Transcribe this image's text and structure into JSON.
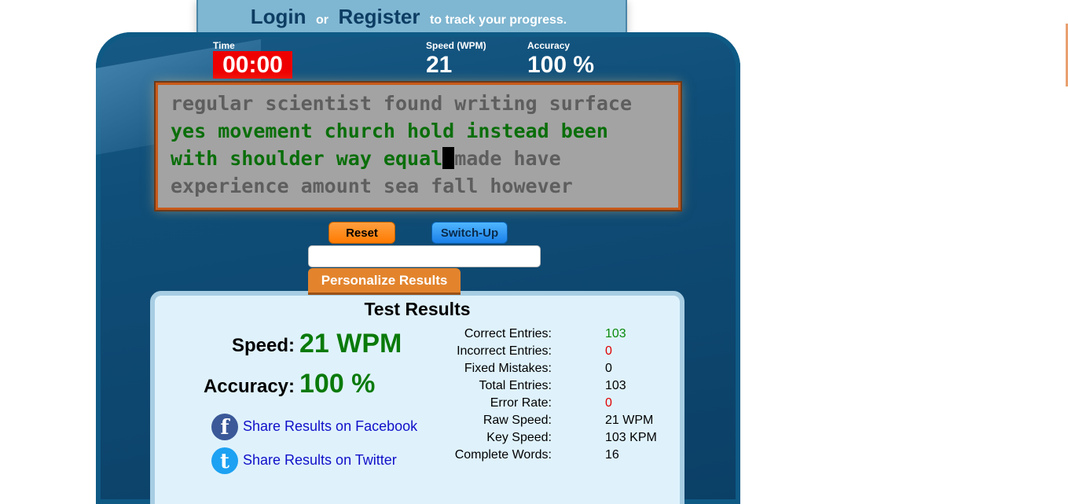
{
  "banner": {
    "login": "Login",
    "or": "or",
    "register": "Register",
    "tagline": "to track your progress."
  },
  "stats": {
    "time_label": "Time",
    "time_value": "00:00",
    "speed_label": "Speed (WPM)",
    "speed_value": "21",
    "accuracy_label": "Accuracy",
    "accuracy_value": "100 %"
  },
  "text_lines": [
    {
      "typed": "",
      "pending": "regular scientist found writing surface"
    },
    {
      "typed": "yes movement church hold instead been",
      "pending": ""
    },
    {
      "typed": "with shoulder way equal",
      "pending": "made have"
    },
    {
      "typed": "",
      "pending": "experience amount sea fall however"
    }
  ],
  "buttons": {
    "reset": "Reset",
    "switch_up": "Switch-Up",
    "personalize": "Personalize Results"
  },
  "input": {
    "value": "",
    "placeholder": ""
  },
  "results": {
    "title": "Test Results",
    "speed_label": "Speed:",
    "speed_value": "21 WPM",
    "accuracy_label": "Accuracy:",
    "accuracy_value": "100 %",
    "share_facebook": "Share Results on Facebook",
    "share_twitter": "Share Results on Twitter",
    "details": [
      {
        "label": "Correct Entries:",
        "value": "103",
        "color": "green"
      },
      {
        "label": "Incorrect Entries:",
        "value": "0",
        "color": "red"
      },
      {
        "label": "Fixed Mistakes:",
        "value": "0",
        "color": "black"
      },
      {
        "label": "Total Entries:",
        "value": "103",
        "color": "black"
      },
      {
        "label": "Error Rate:",
        "value": "0",
        "color": "red"
      },
      {
        "label": "Raw Speed:",
        "value": "21 WPM",
        "color": "black"
      },
      {
        "label": "Key Speed:",
        "value": "103 KPM",
        "color": "black"
      },
      {
        "label": "Complete Words:",
        "value": "16",
        "color": "black"
      }
    ]
  },
  "colors": {
    "panel": "#0b3f66",
    "timer": "#ee0000",
    "typed_text": "#0a6e0a",
    "pending_text": "#5e5e5e",
    "accent_orange": "#e3842d"
  },
  "icons": {
    "facebook": "facebook-icon",
    "twitter": "twitter-icon"
  }
}
